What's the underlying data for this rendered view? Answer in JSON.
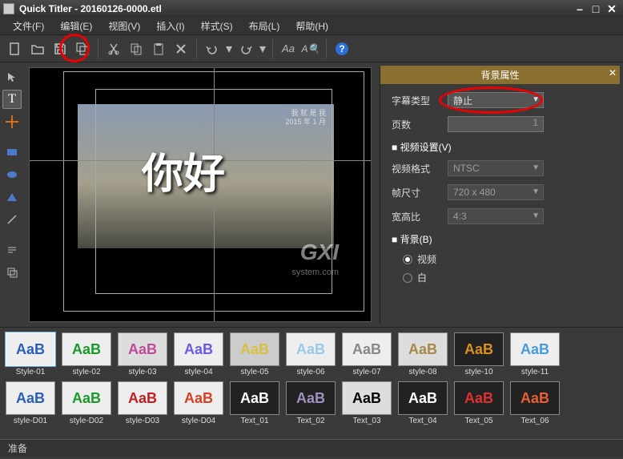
{
  "title": "Quick Titler - 20160126-0000.etl",
  "menus": [
    "文件(F)",
    "编辑(E)",
    "视图(V)",
    "插入(I)",
    "样式(S)",
    "布局(L)",
    "帮助(H)"
  ],
  "canvas": {
    "main_text": "你好",
    "watermark": "GXI",
    "watermark_sub": "system.com",
    "overlay1": "我 就 是 我",
    "overlay2": "2015 年 1 月"
  },
  "props": {
    "panel_title": "背景属性",
    "subtitle_type_label": "字幕类型",
    "subtitle_type_value": "静止",
    "pages_label": "页数",
    "pages_value": "1",
    "video_section": "■ 视频设置(V)",
    "video_format_label": "视频格式",
    "video_format_value": "NTSC",
    "frame_size_label": "帧尺寸",
    "frame_size_value": "720 x 480",
    "aspect_label": "宽高比",
    "aspect_value": "4:3",
    "bg_section": "■ 背景(B)",
    "radio_video": "视频",
    "radio_white": "白"
  },
  "styles_row1": [
    {
      "label": "Style-01",
      "text": "AaB",
      "color": "#2a5fb8",
      "bg": "#eee"
    },
    {
      "label": "style-02",
      "text": "AaB",
      "color": "#1a9a2a",
      "bg": "#eee"
    },
    {
      "label": "style-03",
      "text": "AaB",
      "color": "#c04a9a",
      "bg": "#ddd"
    },
    {
      "label": "style-04",
      "text": "AaB",
      "color": "#6a5ae8",
      "bg": "#eee"
    },
    {
      "label": "style-05",
      "text": "AaB",
      "color": "#d8c040",
      "bg": "#ccc"
    },
    {
      "label": "style-06",
      "text": "AaB",
      "color": "#9ac8e8",
      "bg": "#eee"
    },
    {
      "label": "style-07",
      "text": "AaB",
      "color": "#888",
      "bg": "#eee"
    },
    {
      "label": "style-08",
      "text": "AaB",
      "color": "#a88848",
      "bg": "#ddd"
    },
    {
      "label": "style-10",
      "text": "AaB",
      "color": "#d89020",
      "bg": "#222"
    },
    {
      "label": "style-11",
      "text": "AaB",
      "color": "#4a9ad8",
      "bg": "#eee"
    }
  ],
  "styles_row2": [
    {
      "label": "style-D01",
      "text": "AaB",
      "color": "#2a5fb8",
      "bg": "#eee"
    },
    {
      "label": "style-D02",
      "text": "AaB",
      "color": "#1a9a2a",
      "bg": "#eee"
    },
    {
      "label": "style-D03",
      "text": "AaB",
      "color": "#c02020",
      "bg": "#eee"
    },
    {
      "label": "style-D04",
      "text": "AaB",
      "color": "#d84020",
      "bg": "#eee"
    },
    {
      "label": "Text_01",
      "text": "AaB",
      "color": "#fff",
      "bg": "#222"
    },
    {
      "label": "Text_02",
      "text": "AaB",
      "color": "#a090c0",
      "bg": "#222"
    },
    {
      "label": "Text_03",
      "text": "AaB",
      "color": "#000",
      "bg": "#ddd"
    },
    {
      "label": "Text_04",
      "text": "AaB",
      "color": "#fff",
      "bg": "#222"
    },
    {
      "label": "Text_05",
      "text": "AaB",
      "color": "#e03030",
      "bg": "#222"
    },
    {
      "label": "Text_06",
      "text": "AaB",
      "color": "#e86030",
      "bg": "#222"
    }
  ],
  "status": "准备"
}
